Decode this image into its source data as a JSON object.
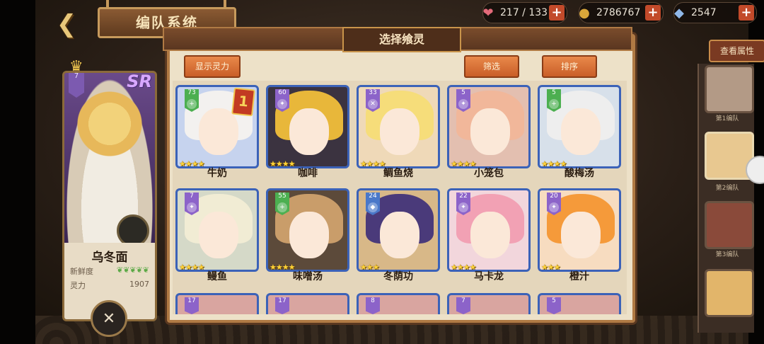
{
  "header": {
    "back_glyph": "❮",
    "title": "编队系统"
  },
  "resources": [
    {
      "icon": "heart-icon",
      "glyph": "❤",
      "value": "217 / 133",
      "color": "#e36a7a",
      "plus": "+"
    },
    {
      "icon": "coin-icon",
      "glyph": "●",
      "value": "2786767",
      "color": "#d9a63a",
      "plus": "+"
    },
    {
      "icon": "crystal-icon",
      "glyph": "◆",
      "value": "2547",
      "color": "#8fb7e8",
      "plus": "+"
    }
  ],
  "hero": {
    "level": "7",
    "rarity": "SR",
    "name": "乌冬面",
    "stat1_label": "新鲜度",
    "stat2_label": "灵力",
    "stat2_value": "1907",
    "freshness_leaves": "❦❦❦❦❦",
    "bottom_icon": "✕"
  },
  "modal": {
    "title": "选择飨灵",
    "btn_show": "显示灵力",
    "btn_filter": "筛选",
    "btn_sort": "排序"
  },
  "right_panel": {
    "view_attr": "查看属性",
    "team1": "第1编队",
    "team2": "第2编队",
    "team3": "第3编队"
  },
  "cards": [
    {
      "name": "牛奶",
      "level": "73",
      "type": "+",
      "type_color": "#4caf50",
      "stars": "★★★★",
      "hair": "#f3f1ef",
      "bg": "#c6d3ee",
      "badge": "1"
    },
    {
      "name": "咖啡",
      "level": "60",
      "type": "✦",
      "type_color": "#8c63c9",
      "stars": "★★★★",
      "hair": "#e8b73a",
      "bg": "#3b3340"
    },
    {
      "name": "鲷鱼烧",
      "level": "33",
      "type": "✕",
      "type_color": "#8c63c9",
      "stars": "★★★★",
      "hair": "#f6dd7a",
      "bg": "#efd9b8"
    },
    {
      "name": "小笼包",
      "level": "5",
      "type": "✦",
      "type_color": "#8c63c9",
      "stars": "★★★★",
      "hair": "#f1b79a",
      "bg": "#e3bfb0"
    },
    {
      "name": "酸梅汤",
      "level": "5",
      "type": "+",
      "type_color": "#4caf50",
      "stars": "★★★★",
      "hair": "#eeeeee",
      "bg": "#d7e0ea"
    },
    {
      "name": "鳗鱼",
      "level": "7",
      "type": "✦",
      "type_color": "#8c63c9",
      "stars": "★★★★",
      "hair": "#f1ecd4",
      "bg": "#d5d9c8"
    },
    {
      "name": "味噌汤",
      "level": "55",
      "type": "+",
      "type_color": "#4caf50",
      "stars": "★★★★",
      "hair": "#c99d6a",
      "bg": "#5c4a3a"
    },
    {
      "name": "冬荫功",
      "level": "24",
      "type": "◆",
      "type_color": "#4a78c9",
      "stars": "★★★",
      "hair": "#4a3a7a",
      "bg": "#d8b888"
    },
    {
      "name": "马卡龙",
      "level": "22",
      "type": "✦",
      "type_color": "#8c63c9",
      "stars": "★★★★",
      "hair": "#f2a1b4",
      "bg": "#f2d6dc"
    },
    {
      "name": "橙汁",
      "level": "20",
      "type": "✦",
      "type_color": "#8c63c9",
      "stars": "★★★",
      "hair": "#f59a3a",
      "bg": "#f7dcc0"
    }
  ],
  "partial_levels": [
    "17",
    "17",
    "8",
    "7",
    "5"
  ]
}
